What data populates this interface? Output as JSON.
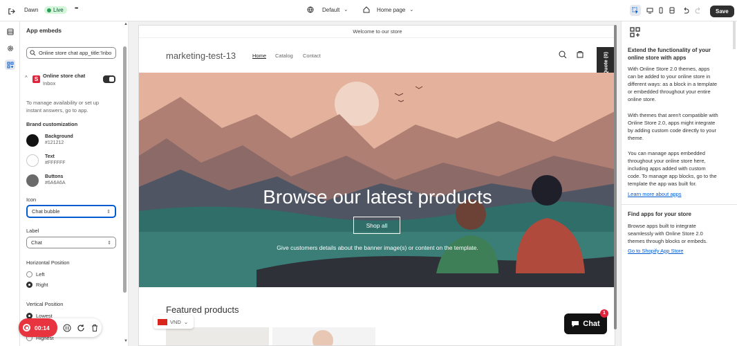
{
  "topbar": {
    "theme_name": "Dawn",
    "live_badge": "Live",
    "more": "•••",
    "device_select": "Default",
    "page_select": "Home page",
    "save_label": "Save"
  },
  "panel": {
    "title": "App embeds",
    "search_value": "Online store chat app_title:'Inbo",
    "app_name": "Online store chat",
    "app_sub": "Inbox",
    "app_icon_letter": "S",
    "help": "To manage availability or set up instant answers, go to app.",
    "brand_heading": "Brand customization",
    "colors": [
      {
        "label": "Background",
        "hex": "#121212"
      },
      {
        "label": "Text",
        "hex": "#FFFFFF"
      },
      {
        "label": "Buttons",
        "hex": "#6A6A6A"
      }
    ],
    "icon_label": "Icon",
    "icon_value": "Chat bubble",
    "label_label": "Label",
    "label_value": "Chat",
    "hpos_label": "Horizontal Position",
    "hpos_options": [
      "Left",
      "Right"
    ],
    "vpos_label": "Vertical Position",
    "vpos_options": [
      "Lowest",
      "Highest"
    ]
  },
  "store": {
    "announcement": "Welcome to our store",
    "logo": "marketing-test-13",
    "nav": [
      "Home",
      "Catalog",
      "Contact"
    ],
    "quote_tab": "View Quote (0)",
    "hero_title": "Browse our latest products",
    "hero_button": "Shop all",
    "hero_caption": "Give customers details about the banner image(s) or content on the template.",
    "featured": "Featured products",
    "currency": "VND",
    "chat_button": "Chat",
    "chat_badge": "1"
  },
  "right_panel": {
    "heading": "Extend the functionality of your online store with apps",
    "p1": "With Online Store 2.0 themes, apps can be added to your online store in different ways: as a block in a template or embedded throughout your entire online store.",
    "p2": "With themes that aren't compatible with Online Store 2.0, apps might integrate by adding custom code directly to your theme.",
    "p3": "You can manage apps embedded throughout your online store here, including apps added with custom code. To manage app blocks, go to the template the app was built for.",
    "link1": "Learn more about apps",
    "heading2": "Find apps for your store",
    "p4": "Browse apps built to integrate seamlessly with Online Store 2.0 themes through blocks or embeds.",
    "link2": "Go to Shopify App Store"
  },
  "recorder": {
    "time": "00:14"
  }
}
